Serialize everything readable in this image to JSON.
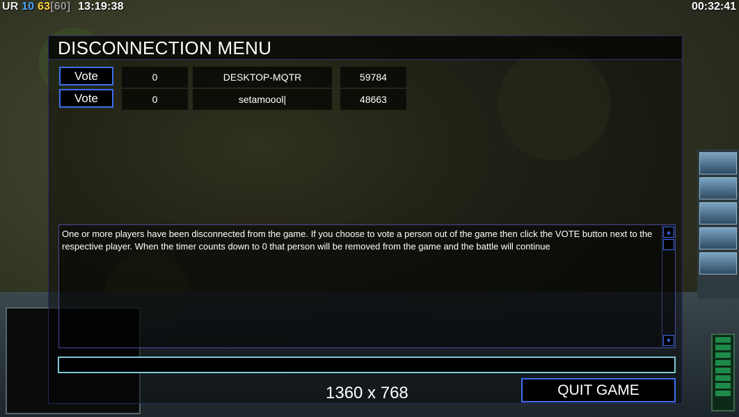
{
  "hud": {
    "prefix": "UR",
    "num1": "10",
    "num2": "63",
    "num3": "[60]",
    "clock": "13:19:38",
    "timer": "00:32:41"
  },
  "dialog": {
    "title": "DISCONNECTION MENU",
    "players": [
      {
        "vote_label": "Vote",
        "count": "0",
        "name": "DESKTOP-MQTR",
        "port": "59784"
      },
      {
        "vote_label": "Vote",
        "count": "0",
        "name": "setamoool|",
        "port": "48663"
      }
    ],
    "message": "One or more players have been disconnected from the game. If you choose to vote a person out of the game then click the VOTE button next to the respective player. When the timer counts down to 0 that person will be removed from the game and the battle will continue",
    "chat_value": "",
    "resolution": "1360 x 768",
    "quit_label": "QUIT GAME"
  },
  "colors": {
    "button_border": "#3c6ff0",
    "chat_border": "#7ec9d6"
  }
}
